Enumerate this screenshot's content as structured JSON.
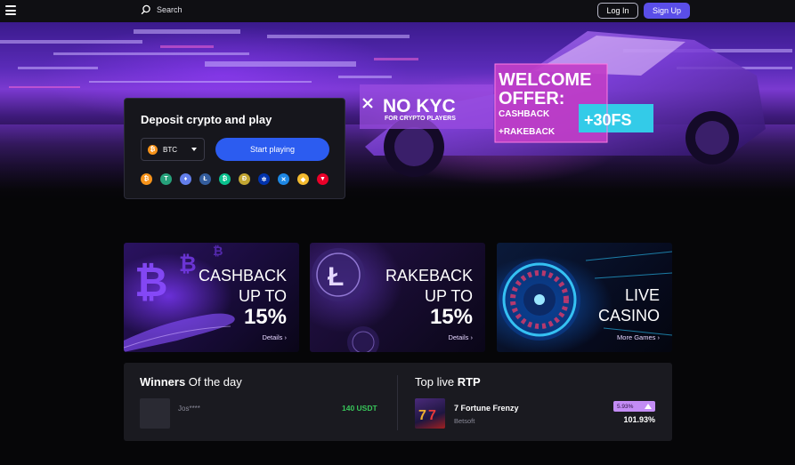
{
  "header": {
    "search_label": "Search",
    "login_label": "Log In",
    "signup_label": "Sign Up"
  },
  "hero": {
    "no_kyc": "NO KYC",
    "no_kyc_sub": "FOR CRYPTO PLAYERS",
    "welcome_line1": "WELCOME",
    "welcome_line2": "OFFER:",
    "welcome_cashback": "CASHBACK",
    "welcome_rakeback": "+RAKEBACK",
    "free_spins": "+30FS"
  },
  "deposit": {
    "title": "Deposit crypto and play",
    "selected_coin": "BTC",
    "start_label": "Start playing",
    "coins": [
      {
        "icon": "bitcoin-icon",
        "glyph": "₿",
        "color": "#f7931a"
      },
      {
        "icon": "tether-icon",
        "glyph": "T",
        "color": "#26a17b"
      },
      {
        "icon": "ethereum-icon",
        "glyph": "♦",
        "color": "#627eea"
      },
      {
        "icon": "litecoin-icon",
        "glyph": "Ł",
        "color": "#345d9d"
      },
      {
        "icon": "bitcoin-cash-icon",
        "glyph": "₿",
        "color": "#0ac18e"
      },
      {
        "icon": "dogecoin-icon",
        "glyph": "Ð",
        "color": "#c2a633"
      },
      {
        "icon": "cardano-icon",
        "glyph": "✲",
        "color": "#0033ad"
      },
      {
        "icon": "ripple-icon",
        "glyph": "✕",
        "color": "#1e88e5"
      },
      {
        "icon": "bnb-icon",
        "glyph": "◆",
        "color": "#f3ba2f"
      },
      {
        "icon": "tron-icon",
        "glyph": "▼",
        "color": "#eb0029"
      }
    ]
  },
  "promos": [
    {
      "line1": "CASHBACK",
      "line2": "UP TO",
      "big": "15%",
      "link": "Details"
    },
    {
      "line1": "RAKEBACK",
      "line2": "UP TO",
      "big": "15%",
      "link": "Details"
    },
    {
      "line1": "LIVE",
      "line2": "CASINO",
      "big": "",
      "link": "More Games"
    }
  ],
  "winners": {
    "title_bold": "Winners",
    "title_rest": " Of the day",
    "entry": {
      "name": "Jos****",
      "amount": "140 USDT"
    }
  },
  "rtp": {
    "title_prefix": "Top live ",
    "title_bold": "RTP",
    "game": {
      "name": "7 Fortune Frenzy",
      "provider": "Betsoft",
      "change": "5.93%",
      "value": "101.93%"
    }
  }
}
